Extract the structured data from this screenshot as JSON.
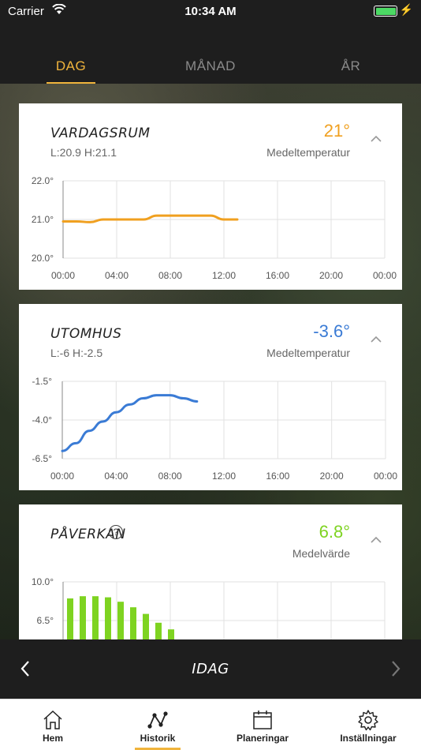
{
  "status": {
    "carrier": "Carrier",
    "time": "10:34 AM"
  },
  "tabs": [
    {
      "label": "DAG",
      "active": true
    },
    {
      "label": "MÅNAD",
      "active": false
    },
    {
      "label": "ÅR",
      "active": false
    }
  ],
  "cards": [
    {
      "title": "VARDAGSRUM",
      "sub": "L:20.9 H:21.1",
      "value": "21°",
      "value_label": "Medeltemperatur",
      "value_color": "#f0a020"
    },
    {
      "title": "UTOMHUS",
      "sub": "L:-6 H:-2.5",
      "value": "-3.6°",
      "value_label": "Medeltemperatur",
      "value_color": "#3a7bd5"
    },
    {
      "title": "PÅVERKAN",
      "value": "6.8°",
      "value_label": "Medelvärde",
      "value_color": "#7ed321"
    }
  ],
  "chart_data": [
    {
      "type": "line",
      "series": [
        {
          "x": [
            "00:00",
            "01:00",
            "02:00",
            "03:00",
            "04:00",
            "05:00",
            "06:00",
            "07:00",
            "08:00",
            "09:00",
            "10:00",
            "11:00",
            "12:00",
            "13:00"
          ],
          "values": [
            20.95,
            20.95,
            20.93,
            21.0,
            21.0,
            21.0,
            21.0,
            21.1,
            21.1,
            21.1,
            21.1,
            21.1,
            21.0,
            21.0
          ]
        }
      ],
      "color": "#f0a020",
      "yticks": [
        "22.0°",
        "21.0°",
        "20.0°"
      ],
      "ylim": [
        20.0,
        22.0
      ],
      "xticks": [
        "00:00",
        "04:00",
        "08:00",
        "12:00",
        "16:00",
        "20:00",
        "00:00"
      ],
      "xlim": [
        0,
        24
      ]
    },
    {
      "type": "line",
      "series": [
        {
          "x": [
            "00:00",
            "01:00",
            "02:00",
            "03:00",
            "04:00",
            "05:00",
            "06:00",
            "07:00",
            "08:00",
            "09:00",
            "10:00"
          ],
          "values": [
            -6.0,
            -5.5,
            -4.7,
            -4.1,
            -3.5,
            -3.0,
            -2.6,
            -2.4,
            -2.4,
            -2.6,
            -2.8
          ]
        }
      ],
      "color": "#3a7bd5",
      "yticks": [
        "-1.5°",
        "-4.0°",
        "-6.5°"
      ],
      "ylim": [
        -6.5,
        -1.5
      ],
      "xticks": [
        "00:00",
        "04:00",
        "08:00",
        "12:00",
        "16:00",
        "20:00",
        "00:00"
      ],
      "xlim": [
        0,
        24
      ]
    },
    {
      "type": "bar",
      "series": [
        {
          "x": [
            "00:00",
            "01:00",
            "02:00",
            "03:00",
            "04:00",
            "05:00",
            "06:00",
            "07:00",
            "08:00"
          ],
          "values": [
            8.5,
            8.7,
            8.7,
            8.6,
            8.2,
            7.7,
            7.1,
            6.3,
            5.7
          ]
        }
      ],
      "color": "#7ed321",
      "yticks": [
        "10.0°",
        "6.5°"
      ],
      "ylim": [
        3.0,
        10.0
      ]
    }
  ],
  "date_bar": {
    "label": "IDAG"
  },
  "nav": [
    {
      "label": "Hem",
      "icon": "home-icon",
      "active": false
    },
    {
      "label": "Historik",
      "icon": "history-icon",
      "active": true
    },
    {
      "label": "Planeringar",
      "icon": "calendar-icon",
      "active": false
    },
    {
      "label": "Inställningar",
      "icon": "gear-icon",
      "active": false
    }
  ]
}
